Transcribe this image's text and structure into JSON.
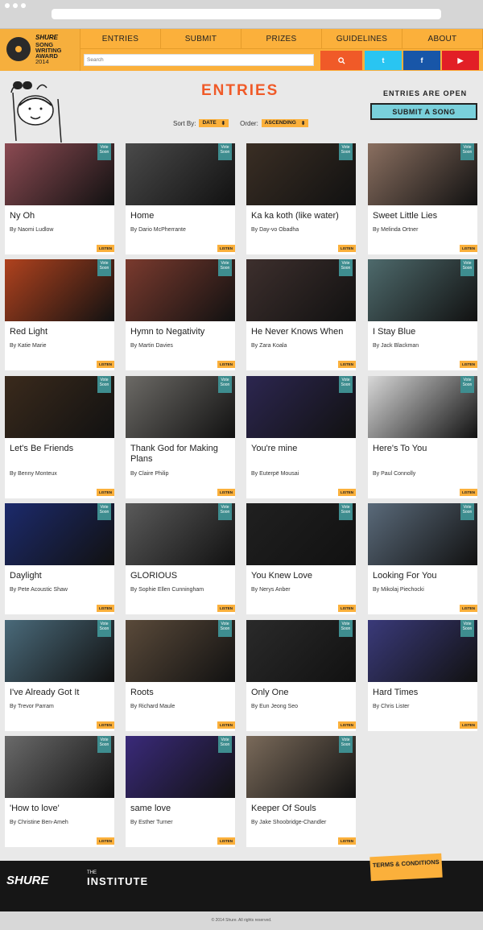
{
  "logo": {
    "brand": "SHURE",
    "line1": "SONG",
    "line2": "WRITING",
    "line3": "AWARD",
    "year": "2014"
  },
  "nav": [
    "ENTRIES",
    "SUBMIT",
    "PRIZES",
    "GUIDELINES",
    "ABOUT"
  ],
  "search": {
    "placeholder": "Search"
  },
  "social": [
    "t",
    "f",
    "▶"
  ],
  "page": {
    "title": "ENTRIES",
    "status": "ENTRIES ARE OPEN",
    "submit": "SUBMIT A SONG"
  },
  "sort": {
    "sort_label": "Sort By:",
    "sort_value": "DATE",
    "order_label": "Order:",
    "order_value": "ASCENDING"
  },
  "vote_label": "Vote Soon",
  "listen_label": "LISTEN",
  "entries": [
    {
      "title": "Ny Oh",
      "by": "By Naomi Ludlow",
      "bg": "#8b4a52"
    },
    {
      "title": "Home",
      "by": "By Dario McPherrante",
      "bg": "#4a4a4a"
    },
    {
      "title": "Ka ka koth (like water)",
      "by": "By Day-vo Obadha",
      "bg": "#3a2e24"
    },
    {
      "title": "Sweet Little Lies",
      "by": "By Melinda Ortner",
      "bg": "#8a6f60"
    },
    {
      "title": "Red Light",
      "by": "By Katie Marie",
      "bg": "#b0421e"
    },
    {
      "title": "Hymn to Negativity",
      "by": "By Martin Davies",
      "bg": "#7a3a2e"
    },
    {
      "title": "He Never Knows When",
      "by": "By Zara Koala",
      "bg": "#3d2f2d"
    },
    {
      "title": "I Stay Blue",
      "by": "By Jack Blackman",
      "bg": "#4e6a6c"
    },
    {
      "title": "Let's Be Friends",
      "by": "By Benny Monteux",
      "bg": "#3a2a1c"
    },
    {
      "title": "Thank God for Making Plans",
      "by": "By Claire Philip",
      "bg": "#6c6a66"
    },
    {
      "title": "You're mine",
      "by": "By Euterpë Mousai",
      "bg": "#2c2650"
    },
    {
      "title": "Here's To You",
      "by": "By Paul Connolly",
      "bg": "#d8d8d8"
    },
    {
      "title": "Daylight",
      "by": "By Pete Acoustic Shaw",
      "bg": "#1c2a6c"
    },
    {
      "title": "GLORIOUS",
      "by": "By Sophie Ellen Cunningham",
      "bg": "#5a5a5a"
    },
    {
      "title": "You Knew Love",
      "by": "By Nerys Anber",
      "bg": "#202020"
    },
    {
      "title": "Looking For You",
      "by": "By Mikolaj Piechocki",
      "bg": "#5a6a7a"
    },
    {
      "title": "I've Already Got It",
      "by": "By Trevor Parram",
      "bg": "#4a6a7a"
    },
    {
      "title": "Roots",
      "by": "By Richard Maule",
      "bg": "#5a4a3a"
    },
    {
      "title": "Only One",
      "by": "By Eun Jeong Seo",
      "bg": "#2a2a2a"
    },
    {
      "title": "Hard Times",
      "by": "By Chris Lister",
      "bg": "#3a3a7a"
    },
    {
      "title": "'How to love'",
      "by": "By Christine Ben-Ameh",
      "bg": "#6a6a6a"
    },
    {
      "title": "same love",
      "by": "By Esther Turner",
      "bg": "#3a2a7a"
    },
    {
      "title": "Keeper Of Souls",
      "by": "By Jake Shoobridge-Chandler",
      "bg": "#7a6a5a"
    }
  ],
  "footer": {
    "shure": "SHURE",
    "inst_small": "THE",
    "inst_big": "INSTITUTE",
    "terms": "TERMS & CONDITIONS",
    "copyright": "© 2014 Shure. All rights reserved."
  }
}
